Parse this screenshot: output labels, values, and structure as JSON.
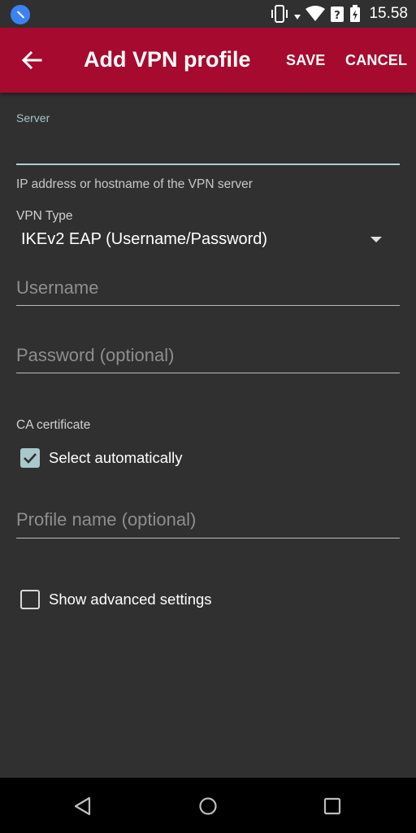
{
  "status_bar": {
    "time": "15.58",
    "icons": [
      "app-notification-icon",
      "vibrate-icon",
      "wifi-icon",
      "signal-icon",
      "battery-icon"
    ]
  },
  "app_bar": {
    "title": "Add VPN profile",
    "save_label": "SAVE",
    "cancel_label": "CANCEL",
    "background_color": "#a60a2e"
  },
  "form": {
    "server": {
      "label": "Server",
      "value": "",
      "helper": "IP address or hostname of the VPN server"
    },
    "vpn_type": {
      "label": "VPN Type",
      "selected": "IKEv2 EAP (Username/Password)"
    },
    "username": {
      "placeholder": "Username",
      "value": ""
    },
    "password": {
      "placeholder": "Password (optional)",
      "value": ""
    },
    "ca_certificate": {
      "label": "CA certificate",
      "select_automatically_label": "Select automatically",
      "select_automatically_checked": true
    },
    "profile_name": {
      "placeholder": "Profile name (optional)",
      "value": ""
    },
    "advanced": {
      "label": "Show advanced settings",
      "checked": false
    }
  },
  "nav_bar": {
    "buttons": [
      "back-icon",
      "home-icon",
      "recents-icon"
    ]
  }
}
